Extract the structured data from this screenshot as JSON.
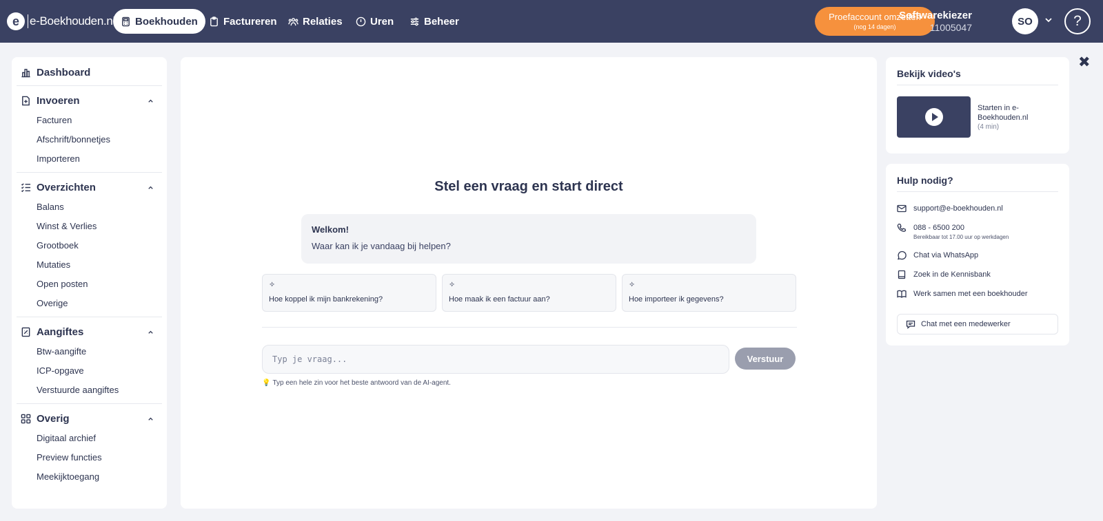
{
  "brand": {
    "logo_letter": "e",
    "logo_text": "e-Boekhouden.nl"
  },
  "nav": {
    "items": [
      {
        "label": "Boekhouden",
        "icon": "calculator-icon"
      },
      {
        "label": "Factureren",
        "icon": "clipboard-icon"
      },
      {
        "label": "Relaties",
        "icon": "people-icon"
      },
      {
        "label": "Uren",
        "icon": "clock-icon"
      },
      {
        "label": "Beheer",
        "icon": "sliders-icon"
      }
    ],
    "trial": {
      "label": "Proefaccount omzetten",
      "sub": "(nog 14 dagen)"
    },
    "company": {
      "name": "Softwarekiezer",
      "id": "11005047"
    },
    "avatar": "SO",
    "help": "?"
  },
  "sidebar": {
    "dashboard": "Dashboard",
    "sections": [
      {
        "title": "Invoeren",
        "items": [
          "Facturen",
          "Afschrift/bonnetjes",
          "Importeren"
        ]
      },
      {
        "title": "Overzichten",
        "items": [
          "Balans",
          "Winst & Verlies",
          "Grootboek",
          "Mutaties",
          "Open posten",
          "Overige"
        ]
      },
      {
        "title": "Aangiftes",
        "items": [
          "Btw-aangifte",
          "ICP-opgave",
          "Verstuurde aangiftes"
        ]
      },
      {
        "title": "Overig",
        "items": [
          "Digitaal archief",
          "Preview functies",
          "Meekijktoegang"
        ]
      }
    ]
  },
  "main": {
    "title": "Stel een vraag en start direct",
    "welcome_title": "Welkom!",
    "welcome_text": "Waar kan ik je vandaag bij helpen?",
    "suggestions": [
      "Hoe koppel ik mijn bankrekening?",
      "Hoe maak ik een factuur aan?",
      "Hoe importeer ik gegevens?"
    ],
    "input_placeholder": "Typ je vraag...",
    "send_label": "Verstuur",
    "tip": "Typ een hele zin voor het beste antwoord van de AI-agent."
  },
  "videos": {
    "title": "Bekijk video's",
    "video_title": "Starten in e-Boekhouden.nl",
    "video_duration": "(4 min)"
  },
  "help_panel": {
    "title": "Hulp nodig?",
    "email": "support@e-boekhouden.nl",
    "phone": "088 - 6500 200",
    "phone_sub": "Bereikbaar tot 17.00 uur op werkdagen",
    "whatsapp": "Chat via WhatsApp",
    "kennisbank": "Zoek in de Kennisbank",
    "boekhouder": "Werk samen met een boekhouder",
    "chat_employee": "Chat met een medewerker"
  },
  "colors": {
    "navy": "#3a4162",
    "accent_orange": "#f6913d",
    "send_gray": "#9a9eae"
  }
}
